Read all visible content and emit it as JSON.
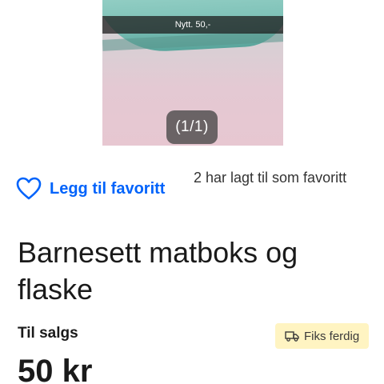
{
  "listing": {
    "image": {
      "caption": "Nytt. 50,-",
      "counter": "(1/1)"
    },
    "favorite": {
      "button_label": "Legg til favoritt",
      "icon": "heart-outline-icon",
      "count_text": "2 har lagt til som favoritt"
    },
    "title": "Barnesett matboks og flaske",
    "status_label": "Til salgs",
    "badge": {
      "icon": "truck-icon",
      "label": "Fiks ferdig"
    },
    "price": "50 kr"
  },
  "colors": {
    "link_blue": "#0063fb",
    "badge_bg": "#fff4c2"
  }
}
